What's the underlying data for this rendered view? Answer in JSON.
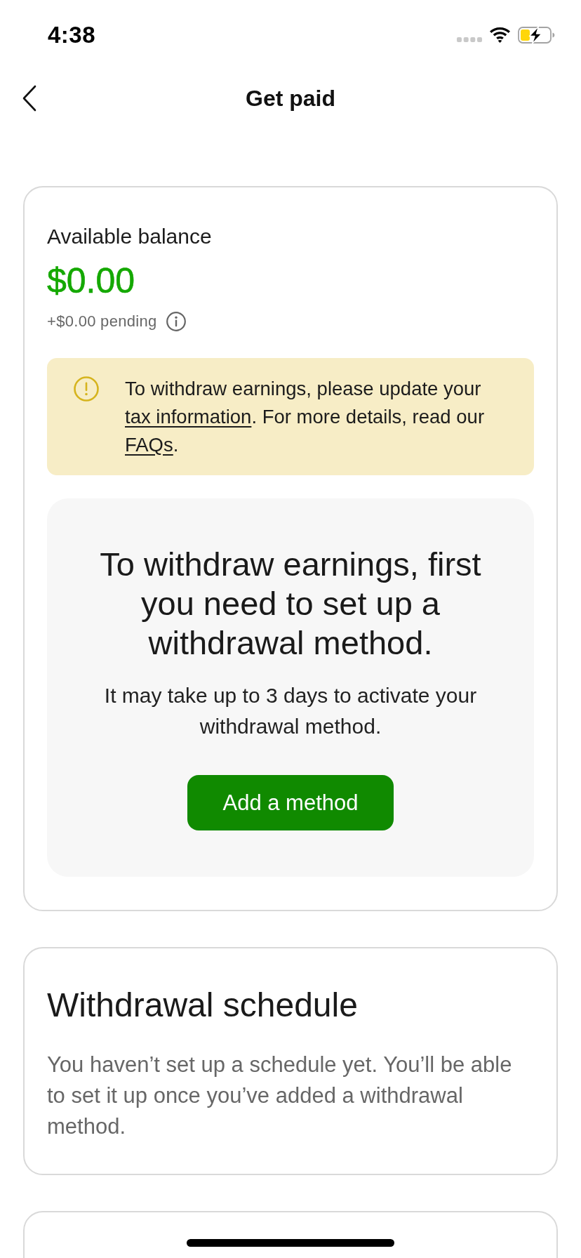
{
  "status_bar": {
    "time": "4:38"
  },
  "header": {
    "title": "Get paid"
  },
  "balance": {
    "label": "Available balance",
    "amount": "$0.00",
    "pending": "+$0.00 pending",
    "notice": {
      "segments": [
        {
          "kind": "text",
          "text": "To withdraw earnings, please update your "
        },
        {
          "kind": "link",
          "text": "tax information"
        },
        {
          "kind": "text",
          "text": ". For more details, read our "
        },
        {
          "kind": "link",
          "text": "FAQs"
        },
        {
          "kind": "text",
          "text": "."
        }
      ]
    },
    "setup": {
      "heading": "To withdraw earnings, first you need to set up a withdrawal method.",
      "note": "It may take up to 3 days to activate your withdrawal method.",
      "button": "Add a method"
    }
  },
  "schedule": {
    "title": "Withdrawal schedule",
    "text": "You haven’t set up a schedule yet. You’ll be able to set it up once you’ve added a withdrawal method."
  }
}
